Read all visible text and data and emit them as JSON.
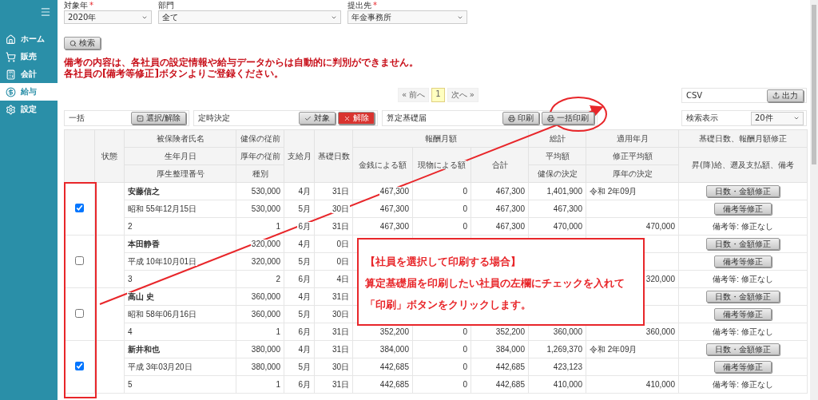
{
  "sidebar": {
    "items": [
      {
        "label": "ホーム",
        "selected": false
      },
      {
        "label": "販売",
        "selected": false
      },
      {
        "label": "会計",
        "selected": false
      },
      {
        "label": "給与",
        "selected": true
      },
      {
        "label": "設定",
        "selected": false
      }
    ]
  },
  "filters": [
    {
      "label": "対象年",
      "mark": "*",
      "value": "2020年"
    },
    {
      "label": "部門",
      "value": "全て"
    },
    {
      "label": "提出先",
      "mark": "*",
      "value": "年金事務所"
    }
  ],
  "search_button": "検索",
  "notes": [
    "備考の内容は、各社員の設定情報や給与データからは自動的に判別ができません。",
    "各社員の[備考等修正]ボタンよりご登録ください。"
  ],
  "pagination": {
    "prev": "« 前へ",
    "pages": [
      {
        "label": "1",
        "selected": true
      }
    ],
    "next": "次へ »"
  },
  "csv": {
    "label": "CSV",
    "button": "出力"
  },
  "bulk_panels": [
    {
      "label": "一括",
      "buttons": [
        {
          "label": "選択/解除",
          "kind": "toggle"
        }
      ]
    },
    {
      "label": "定時決定",
      "buttons": [
        {
          "label": "対象",
          "kind": "check"
        },
        {
          "label": "解除",
          "kind": "danger"
        }
      ]
    },
    {
      "label": "算定基礎届",
      "buttons": [
        {
          "label": "印刷",
          "kind": "print"
        },
        {
          "label": "一括印刷",
          "kind": "print"
        }
      ]
    }
  ],
  "display": {
    "label": "検索表示",
    "value": "20件"
  },
  "table": {
    "header_rows": [
      [
        "",
        "状態",
        "被保険者氏名",
        "健保の従前",
        "支給月",
        "基礎日数",
        "報酬月額",
        "総計",
        "適用年月",
        "基礎日数、報酬月額修正"
      ],
      [
        "生年月日",
        "厚年の従前",
        "金銭による額",
        "現物による額",
        "合計",
        "平均額",
        "修正平均額",
        "昇(降)給、遡及支払額、備考"
      ],
      [
        "厚生整理番号",
        "種別",
        "健保の決定",
        "厚年の決定"
      ]
    ],
    "employees": [
      {
        "checked": true,
        "rows": [
          [
            "安藤信之",
            "530,000",
            "4月",
            "31日",
            "467,300",
            "0",
            "467,300",
            "1,401,900",
            "令和 2年09月",
            {
              "kind": "button",
              "label": "日数・金額修正"
            }
          ],
          [
            "昭和 55年12月15日",
            "530,000",
            "5月",
            "30日",
            "467,300",
            "0",
            "467,300",
            "467,300",
            null,
            {
              "kind": "button",
              "label": "備考等修正"
            }
          ],
          [
            "2",
            "1",
            "6月",
            "31日",
            "467,300",
            "0",
            "467,300",
            "470,000",
            "470,000",
            {
              "kind": "text",
              "label": "備考等: 修正なし"
            }
          ]
        ]
      },
      {
        "checked": false,
        "rows": [
          [
            "本田静香",
            "320,000",
            "4月",
            "0日",
            null,
            null,
            null,
            null,
            null,
            {
              "kind": "button",
              "label": "日数・金額修正"
            }
          ],
          [
            "平成 10年10月01日",
            "320,000",
            "5月",
            "0日",
            null,
            null,
            null,
            null,
            null,
            {
              "kind": "button",
              "label": "備考等修正"
            }
          ],
          [
            "3",
            "2",
            "6月",
            "4日",
            null,
            null,
            null,
            null,
            "320,000",
            {
              "kind": "text",
              "label": "備考等: 修正なし"
            }
          ]
        ]
      },
      {
        "checked": false,
        "rows": [
          [
            "高山 史",
            "360,000",
            "4月",
            "31日",
            null,
            null,
            null,
            null,
            null,
            {
              "kind": "button",
              "label": "日数・金額修正"
            }
          ],
          [
            "昭和 58年06月16日",
            "360,000",
            "5月",
            "30日",
            null,
            null,
            null,
            null,
            null,
            {
              "kind": "button",
              "label": "備考等修正"
            }
          ],
          [
            "4",
            "1",
            "6月",
            "31日",
            "352,200",
            "0",
            "352,200",
            "360,000",
            "360,000",
            {
              "kind": "text",
              "label": "備考等: 修正なし"
            }
          ]
        ]
      },
      {
        "checked": true,
        "rows": [
          [
            "新井和也",
            "380,000",
            "4月",
            "31日",
            "384,000",
            "0",
            "384,000",
            "1,269,370",
            "令和 2年09月",
            {
              "kind": "button",
              "label": "日数・金額修正"
            }
          ],
          [
            "平成 3年03月20日",
            "380,000",
            "5月",
            "30日",
            "442,685",
            "0",
            "442,685",
            "423,123",
            null,
            {
              "kind": "button",
              "label": "備考等修正"
            }
          ],
          [
            "5",
            "1",
            "6月",
            "31日",
            "442,685",
            "0",
            "442,685",
            "410,000",
            "410,000",
            {
              "kind": "text",
              "label": "備考等: 修正なし"
            }
          ]
        ]
      }
    ]
  },
  "callout": {
    "title": "【社員を選択して印刷する場合】",
    "lines": [
      "算定基礎届を印刷したい社員の左欄にチェックを入れて",
      "「印刷」ボタンをクリックします。"
    ]
  }
}
